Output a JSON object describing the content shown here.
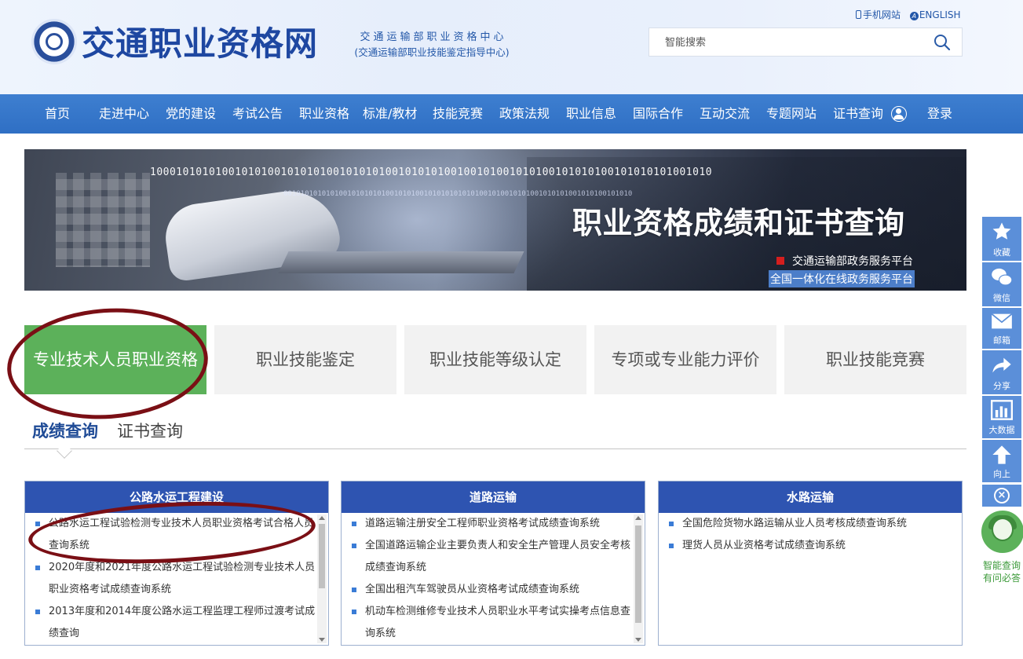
{
  "header": {
    "site_title": "交通职业资格网",
    "org_line1": "交通运输部职业资格中心",
    "org_line2": "(交通运输部职业技能鉴定指导中心)",
    "mobile_link": "手机网站",
    "english_link": "ENGLISH",
    "search_placeholder": "智能搜索"
  },
  "nav": {
    "items": [
      "首页",
      "走进中心",
      "党的建设",
      "考试公告",
      "职业资格",
      "标准/教材",
      "技能竞赛",
      "政策法规",
      "职业信息",
      "国际合作",
      "互动交流",
      "专题网站",
      "证书查询",
      "登录"
    ]
  },
  "banner": {
    "binary_text": "10001010101001010100101010100101010100101010100100101001010100101010100101010101001010",
    "binary_text2": "0010101010101001010101010010101001010101010101001010010101001010101001010100101010",
    "title": "职业资格成绩和证书查询",
    "platform1": "交通运输部政务服务平台",
    "platform2": "全国一体化在线政务服务平台"
  },
  "categories": [
    "专业技术人员职业资格",
    "职业技能鉴定",
    "职业技能等级认定",
    "专项或专业能力评价",
    "职业技能竞赛"
  ],
  "sub_tabs": [
    "成绩查询",
    "证书查询"
  ],
  "panels": [
    {
      "title": "公路水运工程建设",
      "items": [
        "公路水运工程试验检测专业技术人员职业资格考试合格人员查询系统",
        "2020年度和2021年度公路水运工程试验检测专业技术人员职业资格考试成绩查询系统",
        "2013年度和2014年度公路水运工程监理工程师过渡考试成绩查询"
      ]
    },
    {
      "title": "道路运输",
      "items": [
        "道路运输注册安全工程师职业资格考试成绩查询系统",
        "全国道路运输企业主要负责人和安全生产管理人员安全考核成绩查询系统",
        "全国出租汽车驾驶员从业资格考试成绩查询系统",
        "机动车检测维修专业技术人员职业水平考试实操考点信息查询系统"
      ]
    },
    {
      "title": "水路运输",
      "items": [
        "全国危险货物水路运输从业人员考核成绩查询系统",
        "理货人员从业资格考试成绩查询系统"
      ]
    }
  ],
  "toolbar": {
    "favorite": "收藏",
    "wechat": "微信",
    "mail": "邮箱",
    "share": "分享",
    "bigdata": "大数据",
    "top": "向上",
    "close": "×"
  },
  "assistant": {
    "line1": "智能查询",
    "line2": "有问必答"
  },
  "colors": {
    "nav_blue": "#2f6fc4",
    "brand_blue": "#1e47a1",
    "active_green": "#5cb15a",
    "panel_head": "#2e54b1",
    "annotation": "#7a0f15"
  }
}
